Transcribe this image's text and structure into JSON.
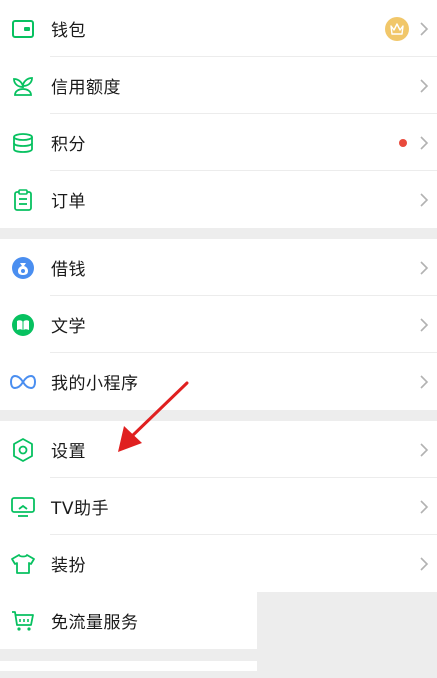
{
  "groups": [
    {
      "items": [
        {
          "label": "钱包",
          "icon": "wallet-icon",
          "badge": "crown"
        },
        {
          "label": "信用额度",
          "icon": "sprout-icon"
        },
        {
          "label": "积分",
          "icon": "coins-icon",
          "badge": "red-dot"
        },
        {
          "label": "订单",
          "icon": "clipboard-icon"
        }
      ]
    },
    {
      "items": [
        {
          "label": "借钱",
          "icon": "money-bag-icon"
        },
        {
          "label": "文学",
          "icon": "book-icon"
        },
        {
          "label": "我的小程序",
          "icon": "mini-program-icon"
        }
      ]
    },
    {
      "items": [
        {
          "label": "设置",
          "icon": "settings-icon"
        },
        {
          "label": "TV助手",
          "icon": "tv-icon"
        },
        {
          "label": "装扮",
          "icon": "tshirt-icon"
        },
        {
          "label": "免流量服务",
          "icon": "cart-icon"
        }
      ]
    }
  ],
  "colors": {
    "accent": "#07c160",
    "blue": "#4a8ef0",
    "badge_gold": "#f1c76a",
    "badge_red": "#e94a3c",
    "annotation_arrow": "#e02020"
  }
}
